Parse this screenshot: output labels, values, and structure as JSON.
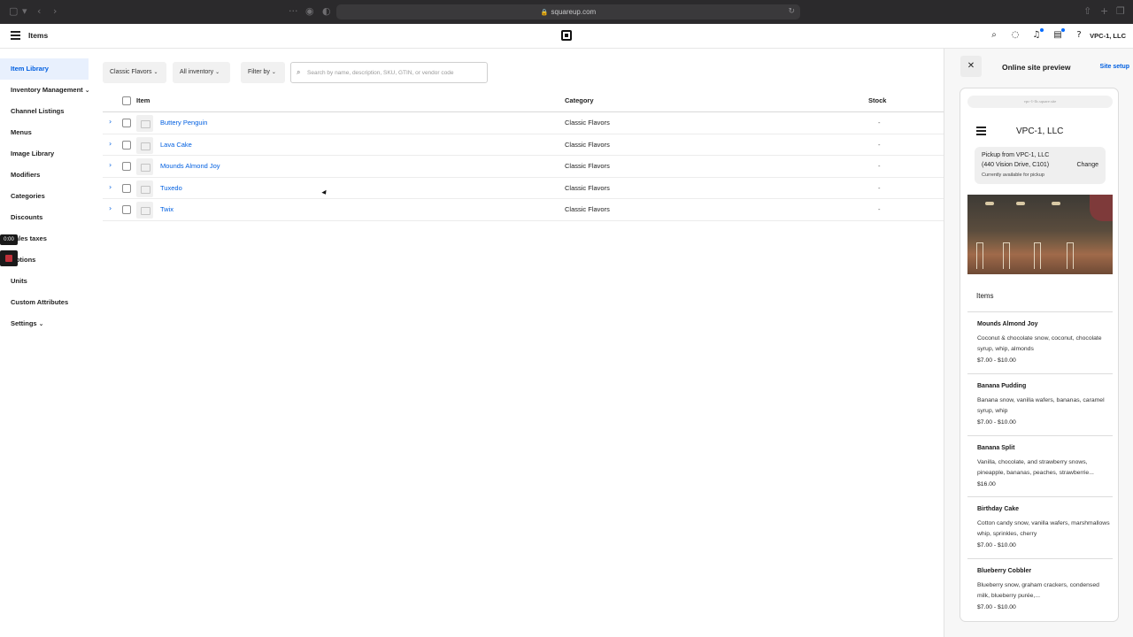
{
  "browser": {
    "url": "squareup.com"
  },
  "header": {
    "title": "Items",
    "org_name": "VPC-1, LLC"
  },
  "sidebar": {
    "items": [
      {
        "label": "Item Library"
      },
      {
        "label": "Inventory Management"
      },
      {
        "label": "Channel Listings"
      },
      {
        "label": "Menus"
      },
      {
        "label": "Image Library"
      },
      {
        "label": "Modifiers"
      },
      {
        "label": "Categories"
      },
      {
        "label": "Discounts"
      },
      {
        "label": "Sales taxes"
      },
      {
        "label": "Options"
      },
      {
        "label": "Units"
      },
      {
        "label": "Custom Attributes"
      },
      {
        "label": "Settings"
      }
    ],
    "recording_time": "0:00"
  },
  "filters": {
    "category": "Classic Flavors",
    "inventory": "All inventory",
    "filter_by": "Filter by",
    "search_placeholder": "Search by name, description, SKU, GTIN, or vendor code"
  },
  "table": {
    "columns": {
      "item": "Item",
      "category": "Category",
      "stock": "Stock"
    },
    "rows": [
      {
        "name": "Buttery Penguin",
        "category": "Classic Flavors",
        "stock": "-"
      },
      {
        "name": "Lava Cake",
        "category": "Classic Flavors",
        "stock": "-"
      },
      {
        "name": "Mounds Almond Joy",
        "category": "Classic Flavors",
        "stock": "-"
      },
      {
        "name": "Tuxedo",
        "category": "Classic Flavors",
        "stock": "-"
      },
      {
        "name": "Twix",
        "category": "Classic Flavors",
        "stock": "-"
      }
    ]
  },
  "preview": {
    "title": "Online site preview",
    "site_setup": "Site setup",
    "mini_url": "vpc-1-llc.square.site",
    "store_name": "VPC-1, LLC",
    "pickup_line1": "Pickup from VPC-1, LLC",
    "pickup_line2": "(440 Vision Drive, C101)",
    "pickup_line3": "Currently available for pickup",
    "change": "Change",
    "items_heading": "Items",
    "menu_items": [
      {
        "name": "Mounds Almond Joy",
        "desc": "Coconut & chocolate snow, coconut, chocolate syrup, whip, almonds",
        "price": "$7.00 - $10.00"
      },
      {
        "name": "Banana Pudding",
        "desc": "Banana snow, vanilla wafers, bananas, caramel syrup, whip",
        "price": "$7.00 - $10.00"
      },
      {
        "name": "Banana Split",
        "desc": "Vanilla, chocolate, and strawberry snows, pineapple, bananas, peaches, strawberrie...",
        "price": "$16.00"
      },
      {
        "name": "Birthday Cake",
        "desc": "Cotton candy snow, vanilla wafers, marshmallows whip, sprinkles, cherry",
        "price": "$7.00 - $10.00"
      },
      {
        "name": "Blueberry Cobbler",
        "desc": "Blueberry snow, graham crackers, condensed milk, blueberry purée,...",
        "price": "$7.00 - $10.00"
      }
    ]
  },
  "colors": {
    "accent": "#005fe0",
    "active_bg": "#e8f0fd",
    "notification_dot": "#006aff"
  }
}
